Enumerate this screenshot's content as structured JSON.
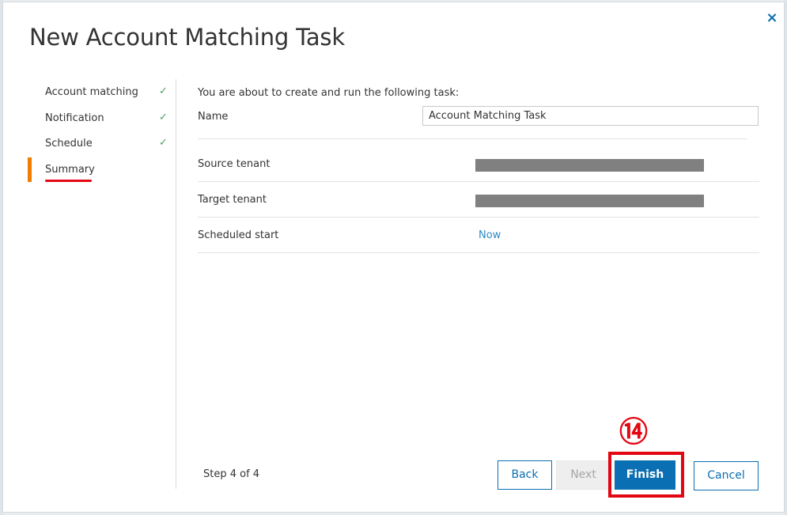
{
  "dialog": {
    "title": "New Account Matching Task",
    "close_icon": "×"
  },
  "nav": {
    "items": [
      {
        "label": "Account matching",
        "check": "✓"
      },
      {
        "label": "Notification",
        "check": "✓"
      },
      {
        "label": "Schedule",
        "check": "✓"
      },
      {
        "label": "Summary",
        "active": true
      }
    ]
  },
  "summary": {
    "intro": "You are about to create and run the following task:",
    "name_label": "Name",
    "name_value": "Account Matching Task",
    "rows": [
      {
        "label": "Source tenant",
        "value": "",
        "redacted": true
      },
      {
        "label": "Target tenant",
        "value": "",
        "redacted": true
      },
      {
        "label": "Scheduled start",
        "value": "Now"
      }
    ]
  },
  "footer": {
    "step_text": "Step 4 of 4",
    "back_label": "Back",
    "next_label": "Next",
    "finish_label": "Finish",
    "cancel_label": "Cancel"
  },
  "annotation": {
    "number": "⑭",
    "color": "#e30613"
  },
  "colors": {
    "accent": "#0b6fb3",
    "active_marker": "#f07c00",
    "check": "#49a35a",
    "link": "#2a8ac8"
  }
}
